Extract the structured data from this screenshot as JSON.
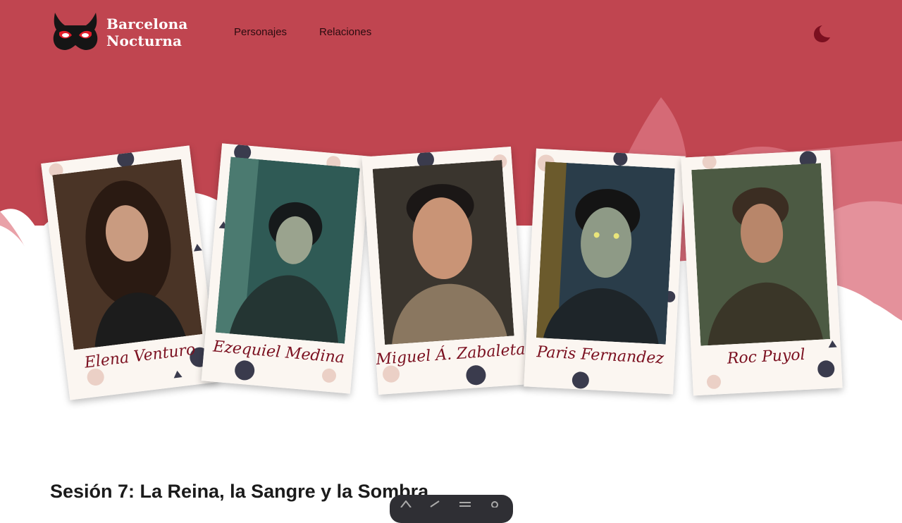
{
  "brand": {
    "name_line1": "Barcelona",
    "name_line2": "Nocturna",
    "logo_icon": "carnival-mask-icon"
  },
  "nav": {
    "items": [
      {
        "label": "Personajes"
      },
      {
        "label": "Relaciones"
      }
    ]
  },
  "theme_toggle": {
    "icon": "moon-icon"
  },
  "colors": {
    "hero_background": "#c04550",
    "accent_dark": "#7b1020",
    "nav_text": "#2a0b0f"
  },
  "characters": [
    {
      "name": "Elena Venturo"
    },
    {
      "name": "Ezequiel Medina"
    },
    {
      "name": "Miguel Á. Zabaleta"
    },
    {
      "name": "Paris Fernandez"
    },
    {
      "name": "Roc Puyol"
    }
  ],
  "session": {
    "title": "Sesión 7: La Reina, la Sangre y la Sombra"
  },
  "floating_toolbar": {
    "icons": [
      "text-icon",
      "brush-icon",
      "menu-icon",
      "gear-icon"
    ]
  }
}
